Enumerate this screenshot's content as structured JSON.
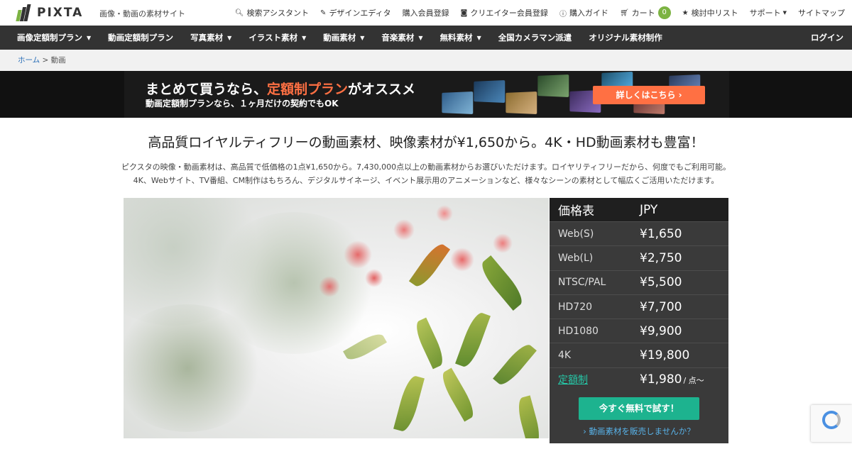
{
  "brand": {
    "logo_text": "PIXTA",
    "tagline": "画像・動画の素材サイト"
  },
  "utility": {
    "items": [
      {
        "icon": "search-icon",
        "label": "検索アシスタント"
      },
      {
        "icon": "pencil-icon",
        "label": "デザインエディタ"
      },
      {
        "icon": "",
        "label": "購入会員登録"
      },
      {
        "icon": "camera-icon",
        "label": "クリエイター会員登録"
      },
      {
        "icon": "info-icon",
        "label": "購入ガイド"
      },
      {
        "icon": "cart-icon",
        "label": "カート"
      },
      {
        "icon": "star-icon",
        "label": "検討中リスト"
      },
      {
        "icon": "",
        "label": "サポート"
      },
      {
        "icon": "",
        "label": "サイトマップ"
      }
    ],
    "cart_count": "0"
  },
  "nav": {
    "items": [
      {
        "label": "画像定額制プラン",
        "has_dropdown": true
      },
      {
        "label": "動画定額制プラン",
        "has_dropdown": false
      },
      {
        "label": "写真素材",
        "has_dropdown": true
      },
      {
        "label": "イラスト素材",
        "has_dropdown": true
      },
      {
        "label": "動画素材",
        "has_dropdown": true
      },
      {
        "label": "音楽素材",
        "has_dropdown": true
      },
      {
        "label": "無料素材",
        "has_dropdown": true
      },
      {
        "label": "全国カメラマン派遣",
        "has_dropdown": false
      },
      {
        "label": "オリジナル素材制作",
        "has_dropdown": false
      }
    ],
    "login": "ログイン"
  },
  "breadcrumb": {
    "home": "ホーム",
    "separator": " > ",
    "current": "動画"
  },
  "banner": {
    "heading_pre": "まとめて買うなら、",
    "heading_highlight": "定額制プラン",
    "heading_post": "がオススメ",
    "sub": "動画定額制プランなら、１ヶ月だけの契約でもOK",
    "button": "詳しくはこちら ›",
    "highlight_color": "#ff7043"
  },
  "headline": "高品質ロイヤルティフリーの動画素材、映像素材が¥1,650から。4K・HD動画素材も豊富！",
  "intro": {
    "line1": "ピクスタの映像・動画素材は、高品質で低価格の1点¥1,650から。7,430,000点以上の動画素材からお選びいただけます。ロイヤリティフリーだから、何度でもご利用可能。",
    "line2": "4K、Webサイト、TV番組、CM制作はもちろん、デジタルサイネージ、イベント展示用のアニメーションなど、様々なシーンの素材として幅広くご活用いただけます。"
  },
  "price_table": {
    "header": {
      "col1": "価格表",
      "col2": "JPY"
    },
    "rows": [
      {
        "label": "Web(S)",
        "price": "¥1,650"
      },
      {
        "label": "Web(L)",
        "price": "¥2,750"
      },
      {
        "label": "NTSC/PAL",
        "price": "¥5,500"
      },
      {
        "label": "HD720",
        "price": "¥7,700"
      },
      {
        "label": "HD1080",
        "price": "¥9,900"
      },
      {
        "label": "4K",
        "price": "¥19,800"
      }
    ],
    "subscription": {
      "label": "定額制",
      "price": "¥1,980",
      "unit": "/ 点〜"
    },
    "cta": "今すぐ無料で試す！",
    "sell_link": "› 動画素材を販売しませんか？"
  },
  "colors": {
    "nav_bg": "#333333",
    "accent_green": "#1db38f",
    "accent_orange": "#ff7043",
    "brand_green": "#7cb342"
  }
}
